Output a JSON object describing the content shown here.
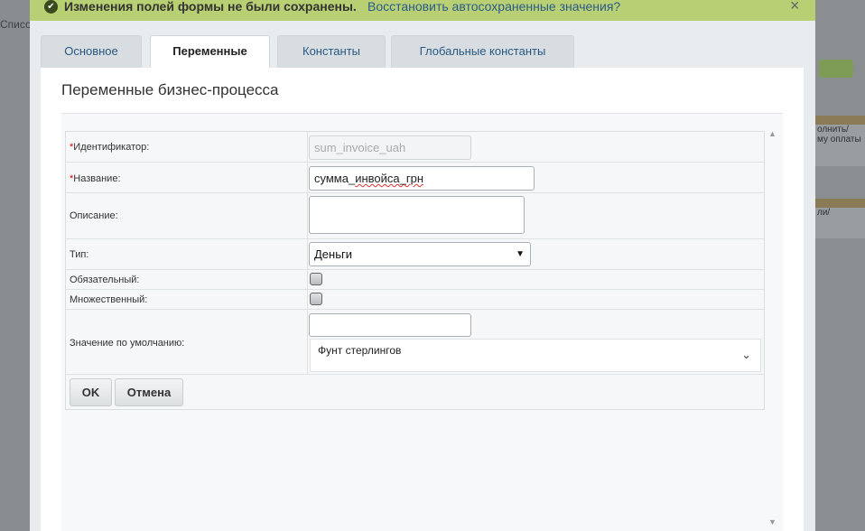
{
  "background": {
    "left_text": "Списо",
    "right_card1_lines": [
      "олнить/",
      "му оплаты"
    ],
    "right_card2_lines": [
      "ли/"
    ]
  },
  "notification": {
    "message": "Изменения полей формы не были сохранены.",
    "restore_link": "Восстановить автосохраненные значения?",
    "close_glyph": "×",
    "check_glyph": "✔"
  },
  "tabs": [
    {
      "label": "Основное"
    },
    {
      "label": "Переменные"
    },
    {
      "label": "Константы"
    },
    {
      "label": "Глобальные константы"
    }
  ],
  "panel": {
    "title": "Переменные бизнес-процесса"
  },
  "form": {
    "id_label": "Идентификатор:",
    "id_value": "sum_invoice_uah",
    "name_label": "Название:",
    "name_value_part1": "сумма_",
    "name_value_spell": "инвойса_грн",
    "description_label": "Описание:",
    "description_value": "",
    "type_label": "Тип:",
    "type_value": "Деньги",
    "required_label": "Обязательный:",
    "multiple_label": "Множественный:",
    "default_label": "Значение по умолчанию:",
    "default_value": "",
    "currency_value": "Фунт стерлингов",
    "required_mark": "*"
  },
  "buttons": {
    "ok": "OK",
    "cancel": "Отмена"
  },
  "colors": {
    "notify_bg": "#b9cf73",
    "link": "#2b5b8a",
    "required": "#dd0000"
  }
}
